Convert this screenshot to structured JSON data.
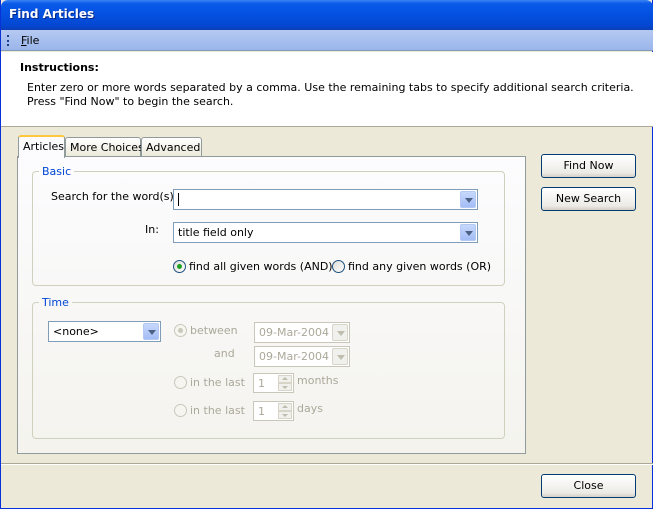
{
  "window": {
    "title": "Find Articles"
  },
  "menubar": {
    "file_label_underlined": "F",
    "file_label_rest": "ile"
  },
  "instructions": {
    "heading": "Instructions:",
    "line1": "Enter zero or more words separated by a comma. Use the remaining tabs to specify additional search criteria.",
    "line2": "Press \"Find Now\" to begin the search."
  },
  "tabs": [
    {
      "label": "Articles",
      "active": true
    },
    {
      "label": "More Choices",
      "active": false
    },
    {
      "label": "Advanced",
      "active": false
    }
  ],
  "basic": {
    "legend": "Basic",
    "search_label": "Search for the word(s):",
    "search_value": "",
    "in_label": "In:",
    "in_value": "title field only",
    "radio_all_label": "find all given words (AND)",
    "radio_all_checked": true,
    "radio_any_label": "find any given words (OR)",
    "radio_any_checked": false
  },
  "time": {
    "legend": "Time",
    "period_value": "<none>",
    "between_label": "between",
    "between_checked": true,
    "date_from": "09-Mar-2004",
    "and_label": "and",
    "date_to": "09-Mar-2004",
    "last_months_label": "in the last",
    "last_months_value": "1",
    "months_label": "months",
    "last_days_label": "in the last",
    "last_days_value": "1",
    "days_label": "days"
  },
  "buttons": {
    "find_now": "Find Now",
    "new_search": "New Search",
    "close": "Close"
  },
  "colors": {
    "title_bar": "#0450e0",
    "accent": "#0046d5",
    "face": "#ece9d8"
  }
}
